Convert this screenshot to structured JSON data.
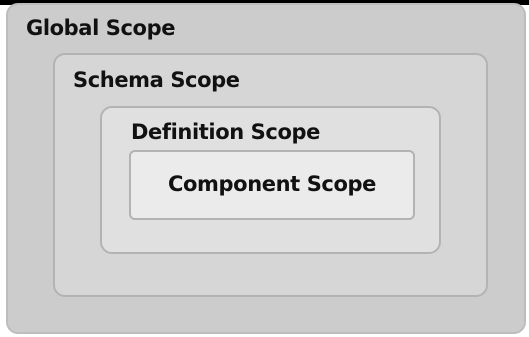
{
  "scopes": {
    "global": "Global Scope",
    "schema": "Schema Scope",
    "definition": "Definition Scope",
    "component": "Component Scope"
  }
}
